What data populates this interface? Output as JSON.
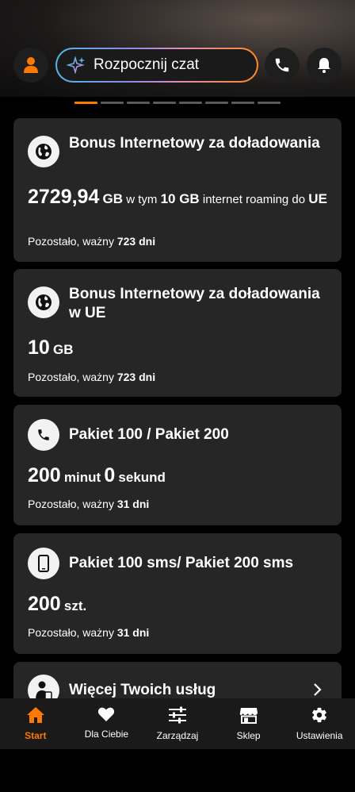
{
  "header": {
    "chat_placeholder": "Rozpocznij czat",
    "pager": {
      "count": 8,
      "active": 0
    }
  },
  "cards": [
    {
      "icon": "globe-icon",
      "title": "Bonus Internetowy za doładowania",
      "amount_value": "2729,94",
      "amount_unit": "GB",
      "amount_mid": "w tym",
      "amount_extra": "10 GB",
      "amount_tail": "internet roaming do",
      "amount_tail2": "UE",
      "valid_prefix": "Pozostało, ważny",
      "valid_value": "723 dni"
    },
    {
      "icon": "globe-icon",
      "title": "Bonus Internetowy za doładowania w UE",
      "amount_value": "10",
      "amount_unit": "GB",
      "valid_prefix": "Pozostało, ważny",
      "valid_value": "723 dni"
    },
    {
      "icon": "phone-icon",
      "title": "Pakiet 100 / Pakiet 200",
      "amount_value": "200",
      "amount_unit": "minut",
      "amount_value2": "0",
      "amount_unit2": "sekund",
      "valid_prefix": "Pozostało, ważny",
      "valid_value": "31 dni"
    },
    {
      "icon": "mobile-icon",
      "title": "Pakiet 100 sms/ Pakiet 200 sms",
      "amount_value": "200",
      "amount_unit": "szt.",
      "valid_prefix": "Pozostało, ważny",
      "valid_value": "31 dni"
    },
    {
      "icon": "person-device-icon",
      "title": "Więcej Twoich usług"
    }
  ],
  "nav": {
    "items": [
      {
        "label": "Start",
        "icon": "home-icon",
        "active": true
      },
      {
        "label": "Dla Ciebie",
        "icon": "heart-icon"
      },
      {
        "label": "Zarządzaj",
        "icon": "sliders-icon"
      },
      {
        "label": "Sklep",
        "icon": "shop-icon"
      },
      {
        "label": "Ustawienia",
        "icon": "gear-icon"
      }
    ]
  },
  "colors": {
    "accent": "#ff7900",
    "card": "#262626",
    "background": "#000000"
  }
}
